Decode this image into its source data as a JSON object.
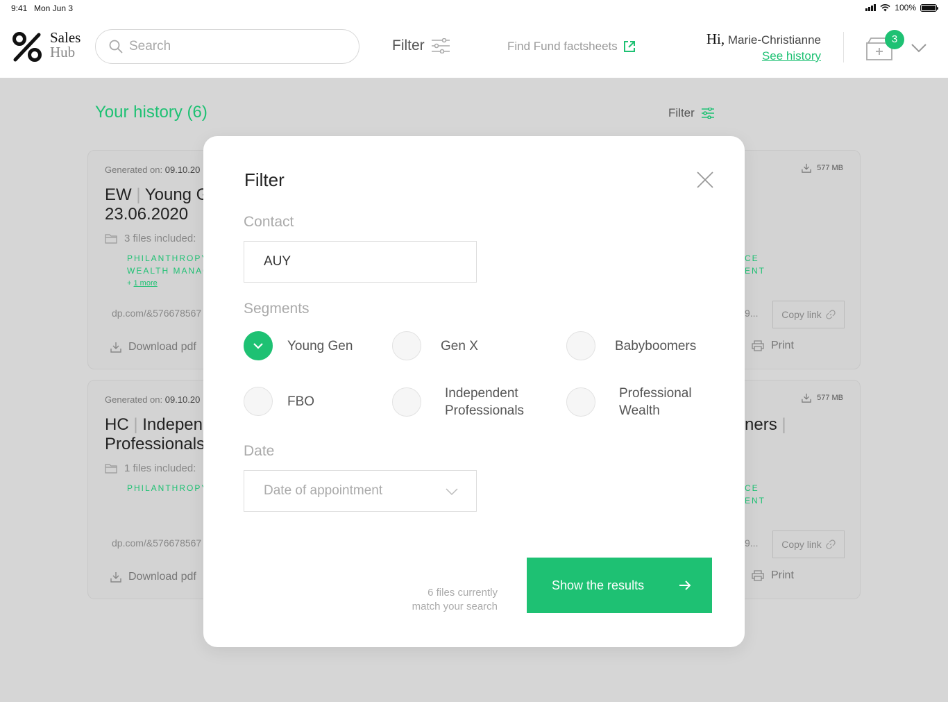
{
  "status_bar": {
    "time": "9:41",
    "date": "Mon Jun 3",
    "battery": "100%"
  },
  "header": {
    "logo_line1": "Sales",
    "logo_line2": "Hub",
    "search_placeholder": "Search",
    "filter_label": "Filter",
    "factsheets_label": "Find Fund factsheets",
    "greeting_hi": "Hi,",
    "user_name": "Marie-Christianne",
    "see_history": "See history",
    "cart_count": "3"
  },
  "history": {
    "title": "Your history (6)",
    "filter_label": "Filter",
    "cards": [
      {
        "generated_label": "Generated on:",
        "generated_date": "09.10.20",
        "code": "EW",
        "title_rest": "Young G",
        "title_line2": "23.06.2020",
        "files": "3 files included:",
        "tags": [
          "PHILANTHROPY",
          "WEALTH MANAG"
        ],
        "more_prefix": "+",
        "more_link": "1 more",
        "link": "dp.com/&576678567",
        "download": "Download pdf",
        "size": "577 MB",
        "tags_right": [
          "CE",
          "ENT"
        ],
        "link_right": "9...",
        "copy": "Copy link",
        "print": "Print"
      },
      {
        "generated_label": "Generated on:",
        "generated_date": "09.10.20",
        "code": "HC",
        "title_rest": "Independ",
        "title_line2": "Professionals",
        "title_right": "ners",
        "files": "1 files included:",
        "tags": [
          "PHILANTHROPY"
        ],
        "link": "dp.com/&576678567",
        "download": "Download pdf",
        "size": "577 MB",
        "tags_right": [
          "CE",
          "ENT"
        ],
        "link_right": "9...",
        "copy": "Copy link",
        "print": "Print"
      }
    ]
  },
  "modal": {
    "title": "Filter",
    "contact_label": "Contact",
    "contact_value": "AUY",
    "segments_label": "Segments",
    "segments": [
      {
        "label": "Young Gen",
        "checked": true
      },
      {
        "label": "Gen X",
        "checked": false
      },
      {
        "label": "Babyboomers",
        "checked": false
      },
      {
        "label": "FBO",
        "checked": false
      },
      {
        "label_line1": "Independent",
        "label_line2": "Professionals",
        "checked": false
      },
      {
        "label_line1": "Professional",
        "label_line2": "Wealth",
        "checked": false
      }
    ],
    "date_label": "Date",
    "date_placeholder": "Date of appointment",
    "count_line1": "6 files currently",
    "count_line2": "match your search",
    "submit": "Show the results"
  },
  "colors": {
    "accent": "#1ec173",
    "overlay": "#d6d6d6"
  }
}
